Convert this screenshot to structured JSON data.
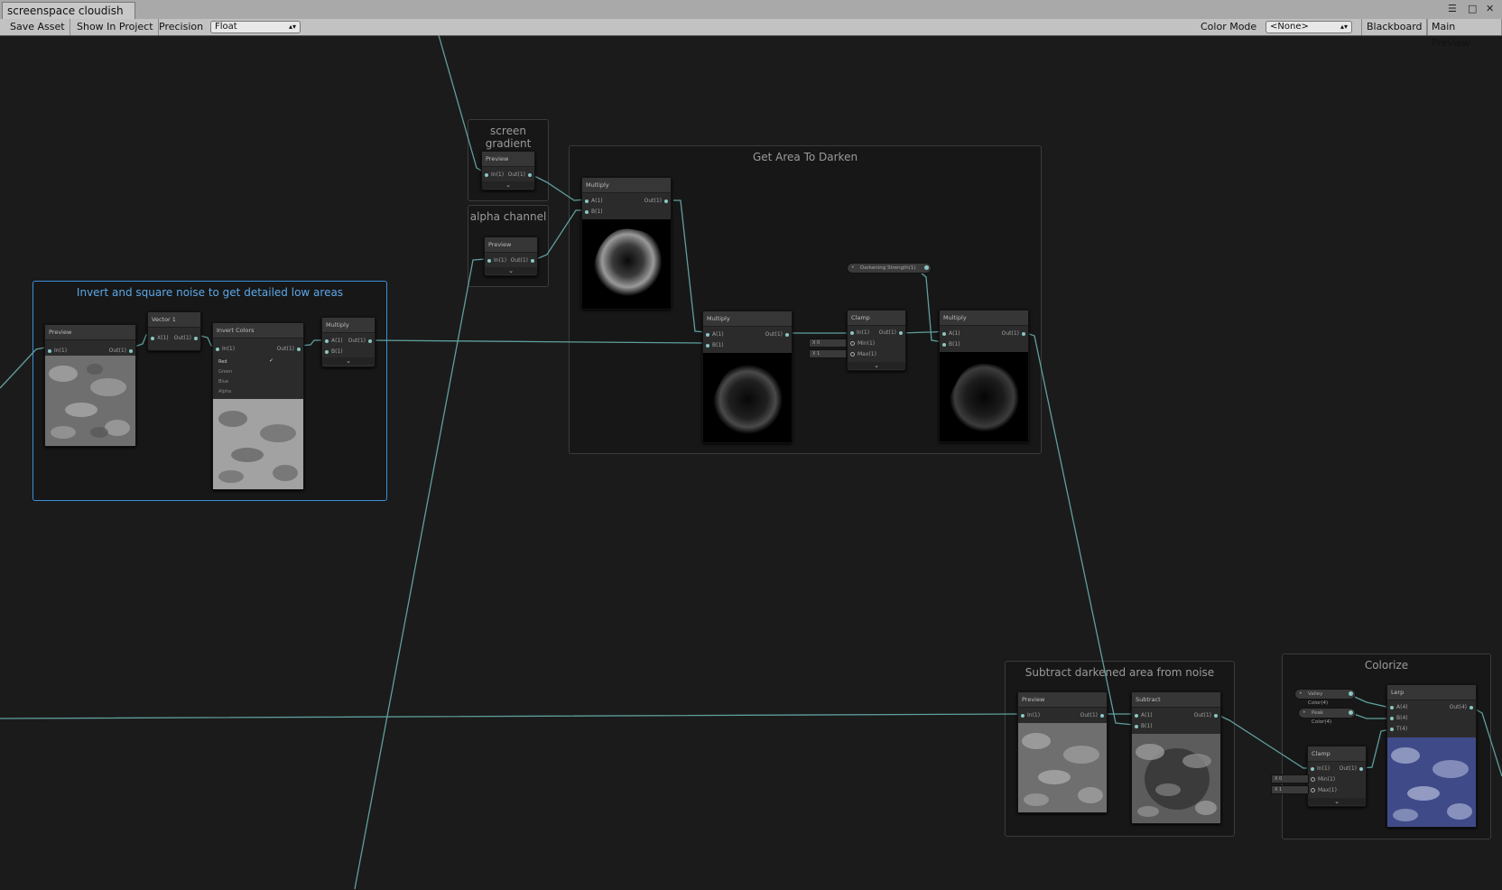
{
  "window": {
    "tab_title": "screenspace cloudish",
    "controls": [
      "☰",
      "□",
      "✕"
    ]
  },
  "toolbar": {
    "save_asset": "Save Asset",
    "show_in_project": "Show In Project",
    "precision_label": "Precision",
    "precision_value": "Float",
    "color_mode_label": "Color Mode",
    "color_mode_value": "<None>",
    "blackboard": "Blackboard",
    "main_preview": "Main Preview"
  },
  "colors": {
    "canvas": "#1b1b1b",
    "wire": "#5f9f9d",
    "port": "#89c7c4",
    "group_selected": "#3c8fd6"
  },
  "groups": {
    "invert": "Invert and square noise to get detailed low areas",
    "screen_gradient": "screen gradient",
    "alpha_channel": "alpha channel",
    "get_area": "Get Area To Darken",
    "subtract": "Subtract darkened area from noise",
    "colorize": "Colorize"
  },
  "nodes": {
    "preview": "Preview",
    "vector1": "Vector 1",
    "invert_colors": "Invert Colors",
    "multiply": "Multiply",
    "clamp": "Clamp",
    "subtract": "Subtract",
    "lerp": "Lerp"
  },
  "ports": {
    "in1": "In(1)",
    "out1": "Out(1)",
    "a1": "A(1)",
    "b1": "B(1)",
    "x1": "X(1)",
    "min1": "Min(1)",
    "max1": "Max(1)",
    "a4": "A(4)",
    "b4": "B(4)",
    "t4": "T(4)",
    "out4": "Out(4)"
  },
  "channels": {
    "red": "Red",
    "green": "Green",
    "blue": "Blue",
    "alpha": "Alpha",
    "check": "✓"
  },
  "inline": {
    "x0": "X  0",
    "x1": "X  1"
  },
  "properties": {
    "darkening_strength": "Darkening Strength(1)",
    "valley_color": "Valley Color(4)",
    "peak_color": "Peak Color(4)"
  },
  "icons": {
    "chevron": "⌄"
  }
}
